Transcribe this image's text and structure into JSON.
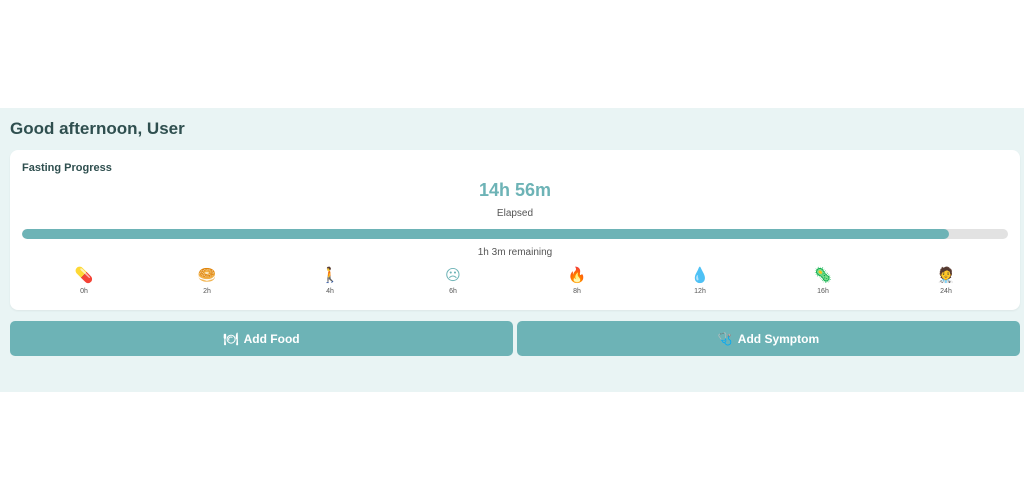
{
  "greeting": "Good afternoon, User",
  "fasting": {
    "title": "Fasting Progress",
    "elapsed": "14h 56m",
    "elapsed_label": "Elapsed",
    "progress_fraction": 0.94,
    "remaining": "1h 3m remaining",
    "milestones": [
      {
        "label": "0h",
        "icon": "pill-icon",
        "glyph": "💊"
      },
      {
        "label": "2h",
        "icon": "bread-icon",
        "glyph": "🥯"
      },
      {
        "label": "4h",
        "icon": "walking-icon",
        "glyph": "🚶"
      },
      {
        "label": "6h",
        "icon": "frown-face-icon",
        "glyph": "☹"
      },
      {
        "label": "8h",
        "icon": "flame-icon",
        "glyph": "🔥"
      },
      {
        "label": "12h",
        "icon": "droplet-icon",
        "glyph": "💧"
      },
      {
        "label": "16h",
        "icon": "microbe-icon",
        "glyph": "🦠"
      },
      {
        "label": "24h",
        "icon": "doctor-icon",
        "glyph": "🧑‍⚕️"
      }
    ]
  },
  "actions": {
    "add_food": "Add Food",
    "add_food_icon": "🍽",
    "add_symptom": "Add Symptom",
    "add_symptom_icon": "🩺"
  },
  "colors": {
    "accent": "#6db3b6",
    "background": "#e9f4f4",
    "heading": "#2f4f4f"
  }
}
